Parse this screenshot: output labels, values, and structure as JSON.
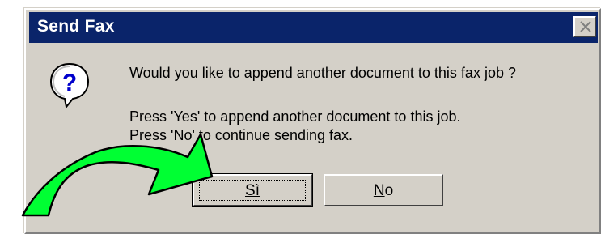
{
  "dialog": {
    "title": "Send Fax",
    "close_label": "Close",
    "icon": "question-icon",
    "message_main": "Would you like to append another document to this fax job ?",
    "message_line1": "Press 'Yes' to append another document to this job.",
    "message_line2": "Press 'No' to continue sending fax.",
    "buttons": {
      "yes": {
        "label": "Sì"
      },
      "no": {
        "label": "No"
      }
    }
  },
  "annotation": {
    "icon": "curved-arrow-icon",
    "color": "#00ff33"
  },
  "colors": {
    "titlebar": "#0a246a",
    "dialog_face": "#d4d0c8"
  }
}
